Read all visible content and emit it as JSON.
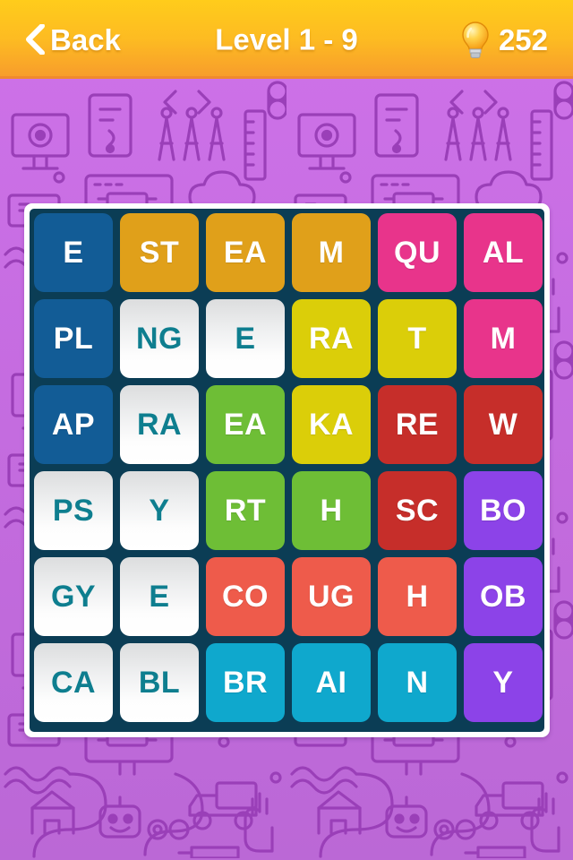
{
  "header": {
    "back_label": "Back",
    "back_icon": "chevron-left-icon",
    "title": "Level 1 - 9",
    "hint_icon": "lightbulb-icon",
    "hint_count": "252",
    "gradient_top": "#FFCC1B",
    "gradient_bottom": "#F79B2C",
    "text_color": "#FFFFFF"
  },
  "background": {
    "pattern": "tech-doodle-pattern",
    "gradient_top": "#CE72E9",
    "gradient_bottom": "#BB68D6",
    "line_color": "#9A3FB8"
  },
  "board": {
    "frame_color": "#FFFFFF",
    "inner_color": "#0B3D55",
    "rows": 6,
    "columns": 6,
    "blank_text_color": "#0E7E8F",
    "tile_colors": {
      "blue": "#125C96",
      "orange": "#E0A01A",
      "pink": "#E8348B",
      "yellow": "#DBCE09",
      "green": "#6EBE36",
      "red": "#C62E2A",
      "purple": "#8C43E8",
      "coral": "#EE5B4B",
      "cyan": "#0FA8CD",
      "blank": "#FFFFFF"
    },
    "tiles": [
      [
        {
          "text": "E",
          "color": "#125C96",
          "style": "blue"
        },
        {
          "text": "ST",
          "color": "#E0A01A",
          "style": "orange"
        },
        {
          "text": "EA",
          "color": "#E0A01A",
          "style": "orange"
        },
        {
          "text": "M",
          "color": "#E0A01A",
          "style": "orange"
        },
        {
          "text": "QU",
          "color": "#E8348B",
          "style": "pink"
        },
        {
          "text": "AL",
          "color": "#E8348B",
          "style": "pink"
        }
      ],
      [
        {
          "text": "PL",
          "color": "#125C96",
          "style": "blue"
        },
        {
          "text": "NG",
          "color": "#FFFFFF",
          "style": "blank"
        },
        {
          "text": "E",
          "color": "#FFFFFF",
          "style": "blank"
        },
        {
          "text": "RA",
          "color": "#DBCE09",
          "style": "yellow"
        },
        {
          "text": "T",
          "color": "#DBCE09",
          "style": "yellow"
        },
        {
          "text": "M",
          "color": "#E8348B",
          "style": "pink"
        }
      ],
      [
        {
          "text": "AP",
          "color": "#125C96",
          "style": "blue"
        },
        {
          "text": "RA",
          "color": "#FFFFFF",
          "style": "blank"
        },
        {
          "text": "EA",
          "color": "#6EBE36",
          "style": "green"
        },
        {
          "text": "KA",
          "color": "#DBCE09",
          "style": "yellow"
        },
        {
          "text": "RE",
          "color": "#C62E2A",
          "style": "red"
        },
        {
          "text": "W",
          "color": "#C62E2A",
          "style": "red"
        }
      ],
      [
        {
          "text": "PS",
          "color": "#FFFFFF",
          "style": "blank"
        },
        {
          "text": "Y",
          "color": "#FFFFFF",
          "style": "blank"
        },
        {
          "text": "RT",
          "color": "#6EBE36",
          "style": "green"
        },
        {
          "text": "H",
          "color": "#6EBE36",
          "style": "green"
        },
        {
          "text": "SC",
          "color": "#C62E2A",
          "style": "red"
        },
        {
          "text": "BO",
          "color": "#8C43E8",
          "style": "purple"
        }
      ],
      [
        {
          "text": "GY",
          "color": "#FFFFFF",
          "style": "blank"
        },
        {
          "text": "E",
          "color": "#FFFFFF",
          "style": "blank"
        },
        {
          "text": "CO",
          "color": "#EE5B4B",
          "style": "coral"
        },
        {
          "text": "UG",
          "color": "#EE5B4B",
          "style": "coral"
        },
        {
          "text": "H",
          "color": "#EE5B4B",
          "style": "coral"
        },
        {
          "text": "OB",
          "color": "#8C43E8",
          "style": "purple"
        }
      ],
      [
        {
          "text": "CA",
          "color": "#FFFFFF",
          "style": "blank"
        },
        {
          "text": "BL",
          "color": "#FFFFFF",
          "style": "blank"
        },
        {
          "text": "BR",
          "color": "#0FA8CD",
          "style": "cyan"
        },
        {
          "text": "AI",
          "color": "#0FA8CD",
          "style": "cyan"
        },
        {
          "text": "N",
          "color": "#0FA8CD",
          "style": "cyan"
        },
        {
          "text": "Y",
          "color": "#8C43E8",
          "style": "purple"
        }
      ]
    ]
  }
}
